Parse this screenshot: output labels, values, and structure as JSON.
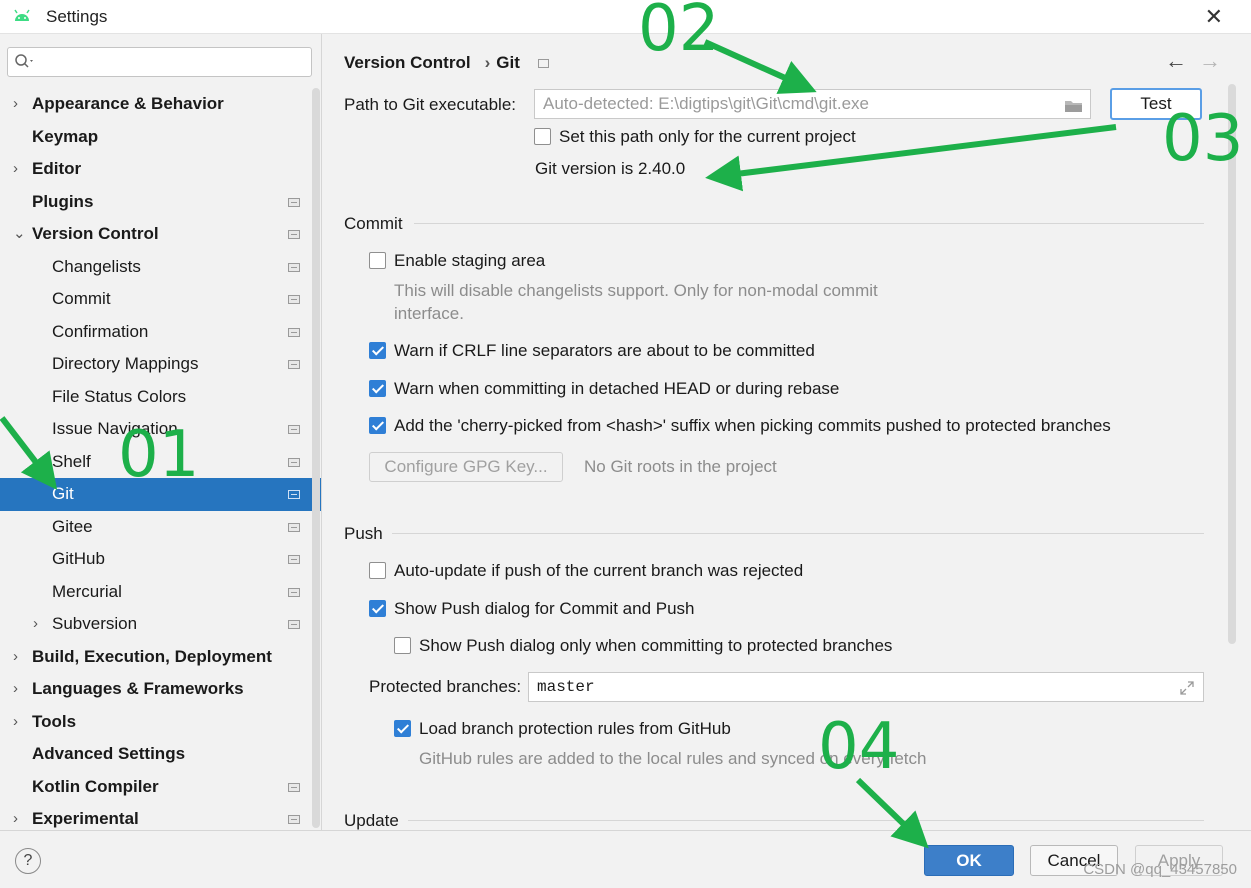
{
  "window": {
    "title": "Settings",
    "close_glyph": "✕"
  },
  "search": {
    "placeholder": ""
  },
  "sidebar": {
    "items": [
      {
        "label": "Appearance & Behavior",
        "level": 0,
        "bold": true,
        "arrow": "›",
        "page_icon": false
      },
      {
        "label": "Keymap",
        "level": 0,
        "bold": true,
        "arrow": "",
        "page_icon": false
      },
      {
        "label": "Editor",
        "level": 0,
        "bold": true,
        "arrow": "›",
        "page_icon": false
      },
      {
        "label": "Plugins",
        "level": 0,
        "bold": true,
        "arrow": "",
        "page_icon": true
      },
      {
        "label": "Version Control",
        "level": 0,
        "bold": true,
        "arrow": "⌄",
        "page_icon": true
      },
      {
        "label": "Changelists",
        "level": 1,
        "bold": false,
        "arrow": "",
        "page_icon": true
      },
      {
        "label": "Commit",
        "level": 1,
        "bold": false,
        "arrow": "",
        "page_icon": true
      },
      {
        "label": "Confirmation",
        "level": 1,
        "bold": false,
        "arrow": "",
        "page_icon": true
      },
      {
        "label": "Directory Mappings",
        "level": 1,
        "bold": false,
        "arrow": "",
        "page_icon": true
      },
      {
        "label": "File Status Colors",
        "level": 1,
        "bold": false,
        "arrow": "",
        "page_icon": false
      },
      {
        "label": "Issue Navigation",
        "level": 1,
        "bold": false,
        "arrow": "",
        "page_icon": true
      },
      {
        "label": "Shelf",
        "level": 1,
        "bold": false,
        "arrow": "",
        "page_icon": true
      },
      {
        "label": "Git",
        "level": 1,
        "bold": false,
        "arrow": "",
        "page_icon": true,
        "selected": true
      },
      {
        "label": "Gitee",
        "level": 1,
        "bold": false,
        "arrow": "",
        "page_icon": true
      },
      {
        "label": "GitHub",
        "level": 1,
        "bold": false,
        "arrow": "",
        "page_icon": true
      },
      {
        "label": "Mercurial",
        "level": 1,
        "bold": false,
        "arrow": "",
        "page_icon": true
      },
      {
        "label": "Subversion",
        "level": 1,
        "bold": false,
        "arrow": "›",
        "page_icon": true
      },
      {
        "label": "Build, Execution, Deployment",
        "level": 0,
        "bold": true,
        "arrow": "›",
        "page_icon": false
      },
      {
        "label": "Languages & Frameworks",
        "level": 0,
        "bold": true,
        "arrow": "›",
        "page_icon": false
      },
      {
        "label": "Tools",
        "level": 0,
        "bold": true,
        "arrow": "›",
        "page_icon": false
      },
      {
        "label": "Advanced Settings",
        "level": 0,
        "bold": true,
        "arrow": "",
        "page_icon": false
      },
      {
        "label": "Kotlin Compiler",
        "level": 0,
        "bold": true,
        "arrow": "",
        "page_icon": true
      },
      {
        "label": "Experimental",
        "level": 0,
        "bold": true,
        "arrow": "›",
        "page_icon": true
      }
    ]
  },
  "breadcrumb": {
    "parent": "Version Control",
    "sep": "›",
    "current": "Git"
  },
  "nav": {
    "back": "←",
    "forward": "→"
  },
  "git_path": {
    "label": "Path to Git executable:",
    "placeholder": "Auto-detected: E:\\digtips\\git\\Git\\cmd\\git.exe",
    "test_button": "Test",
    "project_only_label": "Set this path only for the current project",
    "project_only_checked": false,
    "version_text": "Git version is 2.40.0"
  },
  "commit": {
    "title": "Commit",
    "staging_label": "Enable staging area",
    "staging_checked": false,
    "staging_hint_line1": "This will disable changelists support. Only for non-modal commit",
    "staging_hint_line2": "interface.",
    "crlf_label": "Warn if CRLF line separators are about to be committed",
    "crlf_checked": true,
    "detached_label": "Warn when committing in detached HEAD or during rebase",
    "detached_checked": true,
    "cherry_label": "Add the 'cherry-picked from <hash>' suffix when picking commits pushed to protected branches",
    "cherry_checked": true,
    "gpg_button": "Configure GPG Key...",
    "gpg_status": "No Git roots in the project"
  },
  "push": {
    "title": "Push",
    "auto_update_label": "Auto-update if push of the current branch was rejected",
    "auto_update_checked": false,
    "show_dialog_label": "Show Push dialog for Commit and Push",
    "show_dialog_checked": true,
    "protected_only_label": "Show Push dialog only when committing to protected branches",
    "protected_only_checked": false,
    "protected_branches_label": "Protected branches:",
    "protected_branches_value": "master",
    "load_rules_label": "Load branch protection rules from GitHub",
    "load_rules_checked": true,
    "load_rules_hint": "GitHub rules are added to the local rules and synced on every fetch"
  },
  "update": {
    "title": "Update"
  },
  "buttons": {
    "ok": "OK",
    "cancel": "Cancel",
    "apply": "Apply",
    "help": "?"
  },
  "watermark": "CSDN @qq_43457850",
  "annotations": {
    "a1": "01",
    "a2": "02",
    "a3": "03",
    "a4": "04",
    "color": "#1db04a"
  }
}
